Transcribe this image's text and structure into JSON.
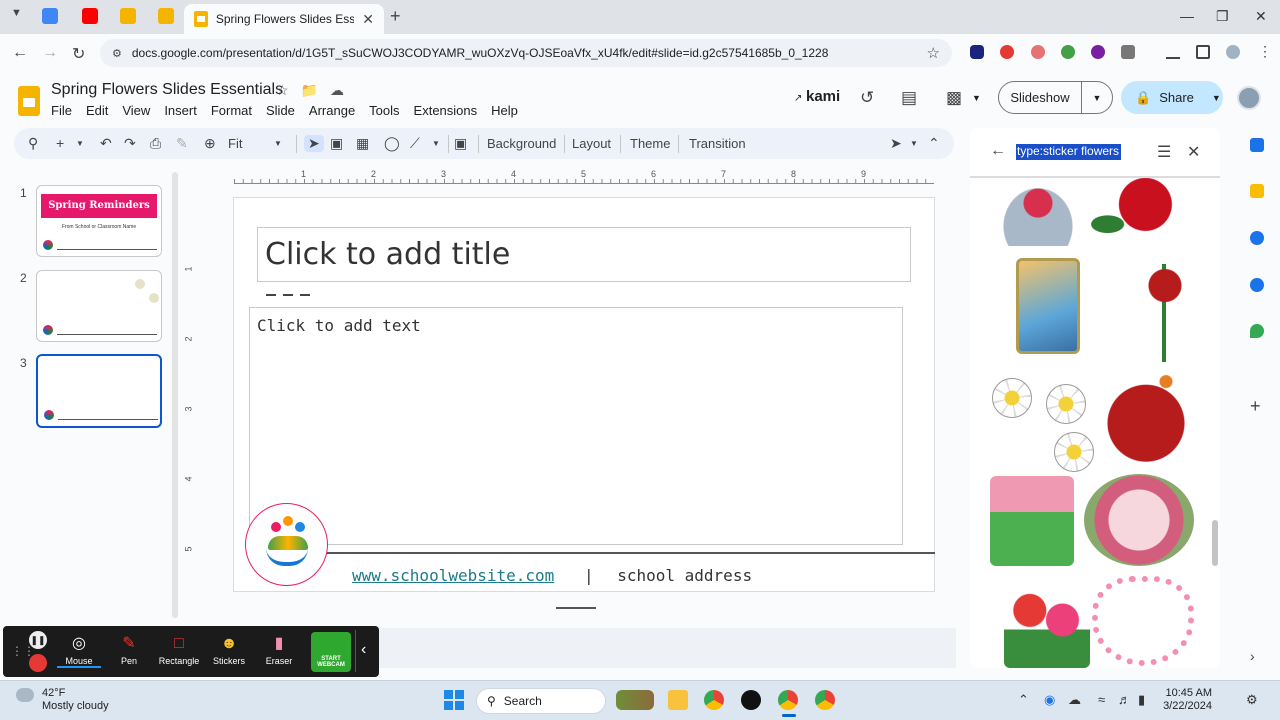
{
  "browser": {
    "active_tab_title": "Spring Flowers Slides Essentials",
    "url": "docs.google.com/presentation/d/1G5T_sSuCWOJ3CODYAMR_wuOXzVq-OJSEoaVfx_xU4fk/edit#slide=id.g2c57541685b_0_1228"
  },
  "app": {
    "doc_title": "Spring Flowers Slides Essentials",
    "menu": [
      "File",
      "Edit",
      "View",
      "Insert",
      "Format",
      "Slide",
      "Arrange",
      "Tools",
      "Extensions",
      "Help"
    ],
    "kami_label": "kami",
    "slideshow_label": "Slideshow",
    "share_label": "Share"
  },
  "toolbar": {
    "zoom": "Fit",
    "background": "Background",
    "layout": "Layout",
    "theme": "Theme",
    "transition": "Transition"
  },
  "filmstrip": {
    "slides": [
      {
        "number": "1",
        "banner": "Spring Reminders",
        "subtitle": "From School or Classroom Name"
      },
      {
        "number": "2"
      },
      {
        "number": "3"
      }
    ]
  },
  "ruler": {
    "h": [
      "1",
      "2",
      "3",
      "4",
      "5",
      "6",
      "7",
      "8",
      "9"
    ],
    "v": [
      "1",
      "2",
      "3",
      "4",
      "5"
    ]
  },
  "slide": {
    "title_placeholder": "Click to add title",
    "body_placeholder": "Click to add text",
    "footer_link": "www.schoolwebsite.com",
    "footer_sep": "|",
    "footer_address": "school address"
  },
  "sidepanel": {
    "search_query": "type:sticker flowers"
  },
  "recorder": {
    "tools": [
      "Mouse",
      "Pen",
      "Rectangle",
      "Stickers",
      "Eraser"
    ],
    "webcam_label": "START WEBCAM"
  },
  "taskbar": {
    "temp": "42°F",
    "weather": "Mostly cloudy",
    "search": "Search",
    "time": "10:45 AM",
    "date": "3/22/2024"
  },
  "colors": {
    "accent_blue": "#0b57d0",
    "share_bg": "#c2e7ff",
    "banner_pink": "#e6186b",
    "slides_yellow": "#f4b400"
  }
}
